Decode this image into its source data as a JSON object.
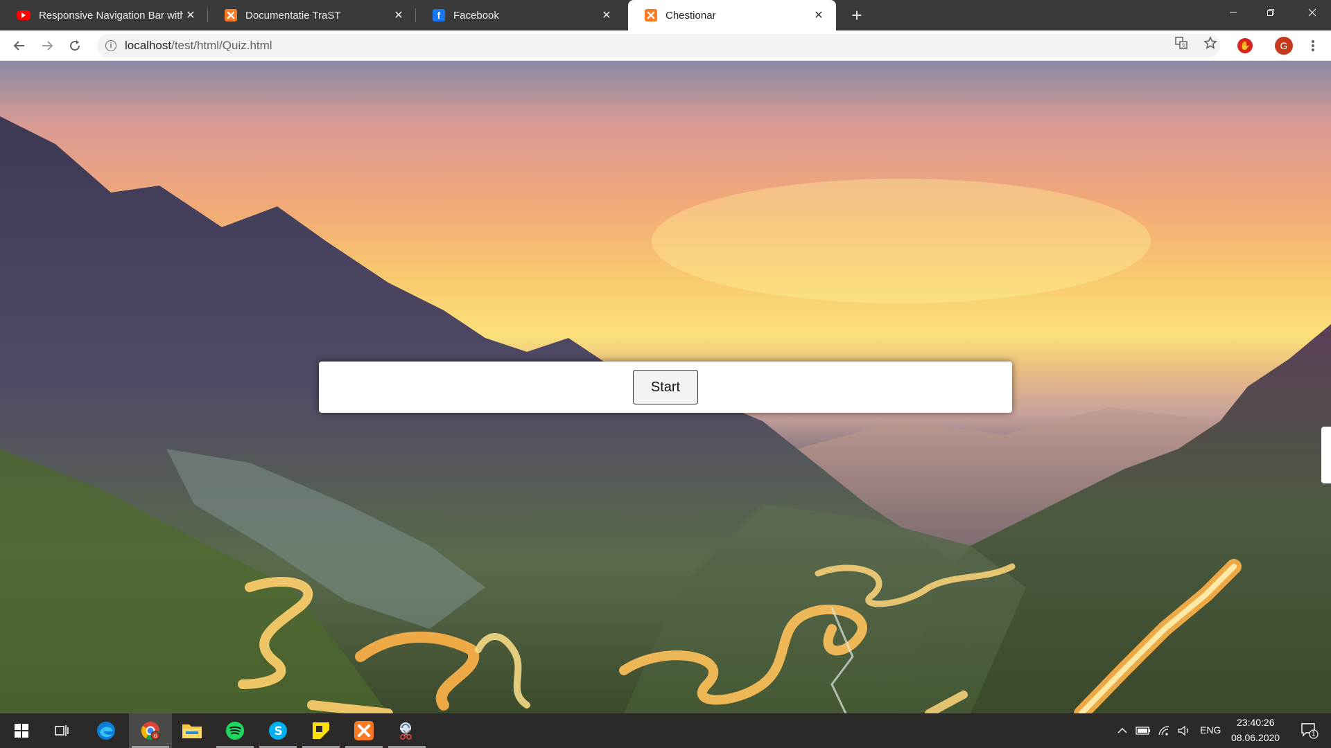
{
  "browser": {
    "tabs": [
      {
        "title": "Responsive Navigation Bar with HTML CSS",
        "icon": "youtube-icon",
        "active": false
      },
      {
        "title": "Documentatie TraST",
        "icon": "xampp-icon",
        "active": false
      },
      {
        "title": "Facebook",
        "icon": "facebook-icon",
        "active": false
      },
      {
        "title": "Chestionar",
        "icon": "xampp-icon",
        "active": true
      }
    ],
    "new_tab_glyph": "+",
    "address": {
      "host": "localhost",
      "path": "/test/html/Quiz.html"
    },
    "avatar_letter": "G"
  },
  "page": {
    "start_button_label": "Start"
  },
  "taskbar": {
    "apps": [
      "windows-start-icon",
      "task-view-icon",
      "edge-icon",
      "chrome-icon",
      "file-explorer-icon",
      "spotify-icon",
      "skype-icon",
      "sticky-notes-icon",
      "xampp-icon",
      "snipping-tool-icon"
    ],
    "language": "ENG",
    "time": "23:40:26",
    "date": "08.06.2020",
    "notification_count": "1"
  },
  "colors": {
    "tabstrip_bg": "#3a3a3a",
    "taskbar_bg": "#2b2a28",
    "xampp_orange": "#fb7a24",
    "youtube_red": "#ff0000",
    "facebook_blue": "#1877f2"
  }
}
